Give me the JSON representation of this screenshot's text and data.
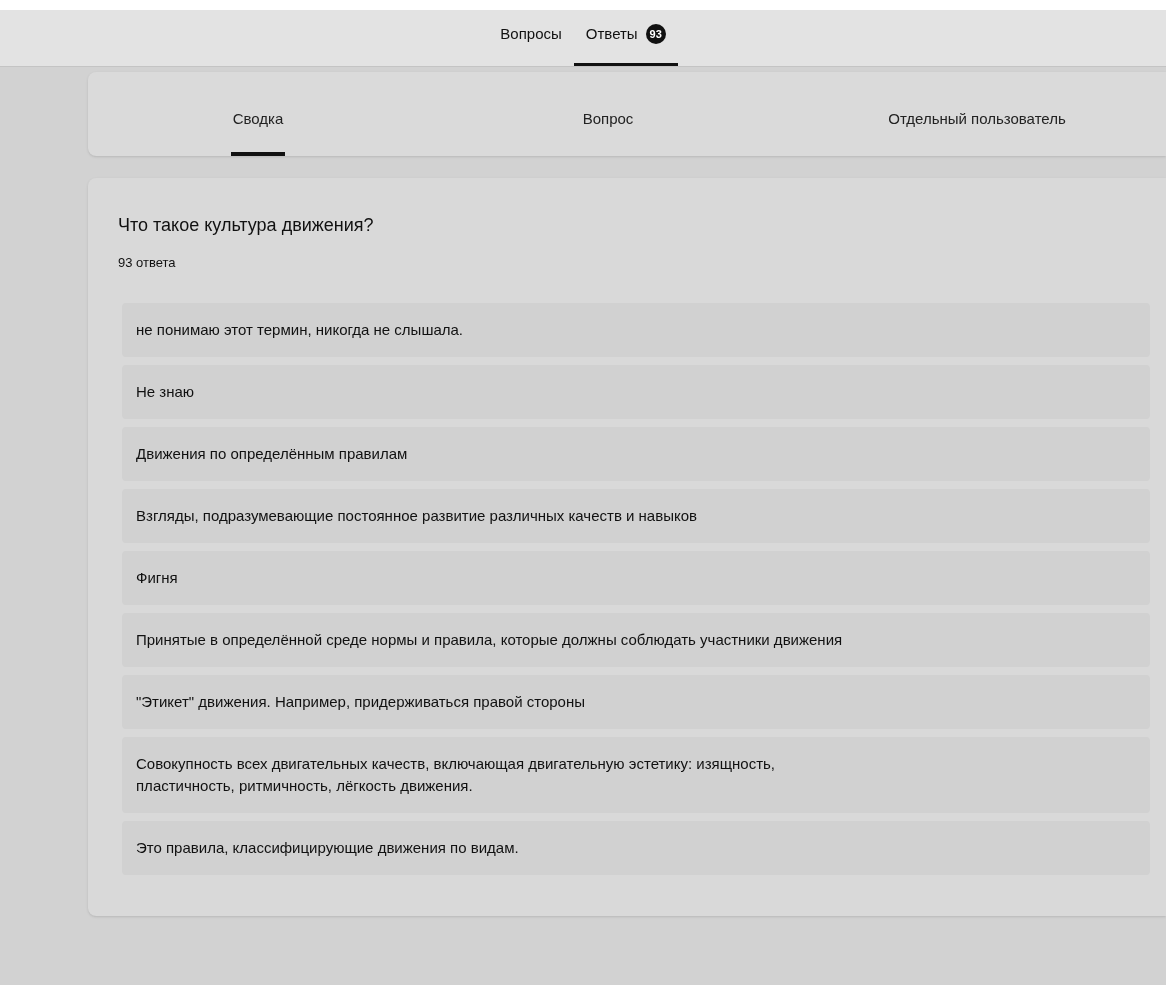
{
  "top_tabs": [
    {
      "label": "Вопросы",
      "selected": false
    },
    {
      "label": "Ответы",
      "selected": true,
      "badge": "93"
    }
  ],
  "view_tabs": [
    {
      "label": "Сводка",
      "selected": true
    },
    {
      "label": "Вопрос",
      "selected": false
    },
    {
      "label": "Отдельный пользователь",
      "selected": false
    }
  ],
  "question": {
    "title": "Что такое культура движения?",
    "count": "93 ответа",
    "answers": [
      "не понимаю этот термин, никогда не слышала.",
      "Не знаю",
      "Движения по определённым правилам",
      "Взгляды, подразумевающие постоянное развитие различных качеств и навыков",
      "Фигня",
      "Принятые в определённой среде нормы и правила, которые должны соблюдать участники движения",
      "\"Этикет\" движения. Например, придерживаться правой стороны",
      "Совокупность всех двигательных качеств, включающая двигательную эстетику: изящность, пластичность, ритмичность, лёгкость движения.",
      "Это правила, классифицирующие движения по видам."
    ]
  }
}
